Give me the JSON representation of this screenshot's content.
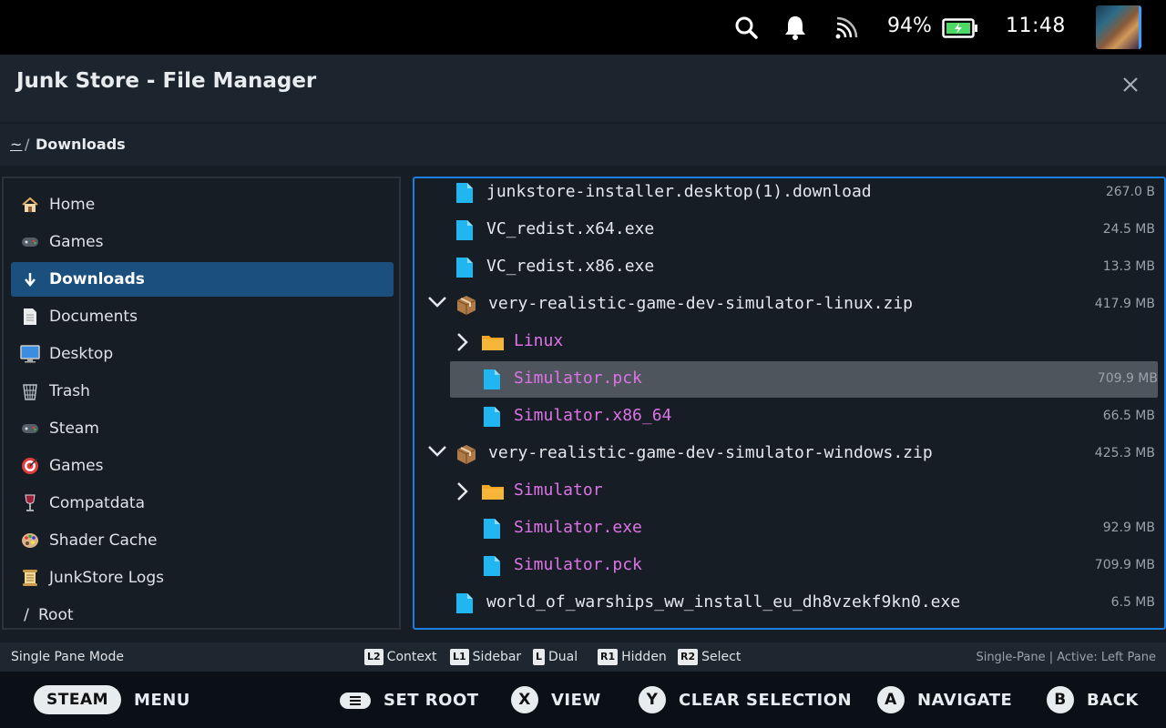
{
  "status": {
    "battery_pct": "94%",
    "clock": "11:48"
  },
  "window": {
    "title": "Junk Store - File Manager"
  },
  "breadcrumb": {
    "home": "~",
    "sep": "/",
    "current": "Downloads"
  },
  "sidebar": {
    "items": [
      {
        "label": "Home",
        "icon": "house-icon"
      },
      {
        "label": "Games",
        "icon": "gamepad-icon"
      },
      {
        "label": "Downloads",
        "icon": "download-arrow-icon",
        "active": true
      },
      {
        "label": "Documents",
        "icon": "document-icon"
      },
      {
        "label": "Desktop",
        "icon": "monitor-icon"
      },
      {
        "label": "Trash",
        "icon": "wastebasket-icon"
      },
      {
        "label": "Steam",
        "icon": "gamepad-icon"
      },
      {
        "label": "Games",
        "icon": "target-icon"
      },
      {
        "label": "Compatdata",
        "icon": "wine-glass-icon"
      },
      {
        "label": "Shader Cache",
        "icon": "palette-icon"
      },
      {
        "label": "JunkStore Logs",
        "icon": "scroll-icon"
      },
      {
        "label": "Root",
        "icon": "slash-icon"
      }
    ]
  },
  "files": [
    {
      "name": "junkstore-installer.desktop(1).download",
      "size": "267.0 B",
      "type": "file",
      "level": 0
    },
    {
      "name": "VC_redist.x64.exe",
      "size": "24.5 MB",
      "type": "file",
      "level": 0
    },
    {
      "name": "VC_redist.x86.exe",
      "size": "13.3 MB",
      "type": "file",
      "level": 0
    },
    {
      "name": "very-realistic-game-dev-simulator-linux.zip",
      "size": "417.9 MB",
      "type": "archive",
      "level": 0,
      "expanded": true
    },
    {
      "name": "Linux",
      "size": "",
      "type": "folder",
      "level": 1,
      "expanded": false
    },
    {
      "name": "Simulator.pck",
      "size": "709.9 MB",
      "type": "file",
      "level": 1,
      "selected": true
    },
    {
      "name": "Simulator.x86_64",
      "size": "66.5 MB",
      "type": "file",
      "level": 1
    },
    {
      "name": "very-realistic-game-dev-simulator-windows.zip",
      "size": "425.3 MB",
      "type": "archive",
      "level": 0,
      "expanded": true
    },
    {
      "name": "Simulator",
      "size": "",
      "type": "folder",
      "level": 1,
      "expanded": false
    },
    {
      "name": "Simulator.exe",
      "size": "92.9 MB",
      "type": "file",
      "level": 1
    },
    {
      "name": "Simulator.pck",
      "size": "709.9 MB",
      "type": "file",
      "level": 1
    },
    {
      "name": "world_of_warships_ww_install_eu_dh8vzekf9kn0.exe",
      "size": "6.5 MB",
      "type": "file",
      "level": 0
    }
  ],
  "hints": {
    "mode": "Single Pane Mode",
    "items": [
      {
        "key": "L2",
        "label": "Context"
      },
      {
        "key": "L1",
        "label": "Sidebar"
      },
      {
        "key": "L",
        "label": "Dual"
      },
      {
        "key": "R1",
        "label": "Hidden"
      },
      {
        "key": "R2",
        "label": "Select"
      }
    ],
    "status": "Single-Pane | Active: Left Pane"
  },
  "footer": {
    "steam": "STEAM",
    "menu": "MENU",
    "set_root": "SET ROOT",
    "x_key": "X",
    "view": "VIEW",
    "y_key": "Y",
    "clear": "CLEAR SELECTION",
    "a_key": "A",
    "navigate": "NAVIGATE",
    "b_key": "B",
    "back": "BACK"
  },
  "colors": {
    "accent": "#1a7fe0",
    "active_item": "#1b4f7d",
    "pink_text": "#dd74e6",
    "file_icon": "#1fb6f2",
    "folder_icon": "#f5a623"
  }
}
